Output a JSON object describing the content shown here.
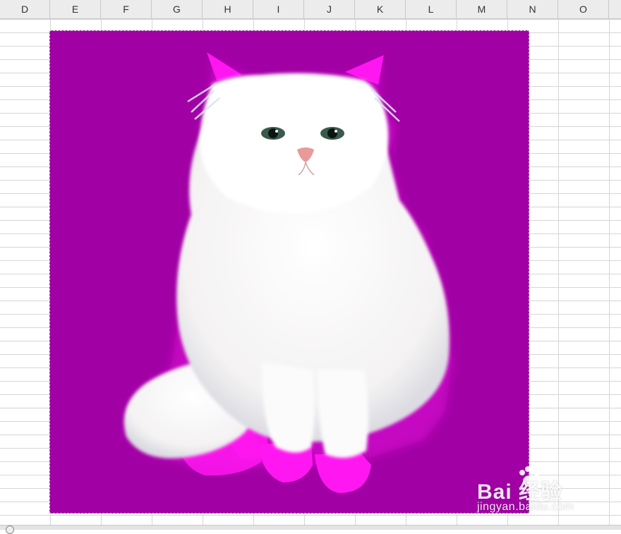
{
  "spreadsheet": {
    "columns": [
      "D",
      "E",
      "F",
      "G",
      "H",
      "I",
      "J",
      "K",
      "L",
      "M",
      "N",
      "O"
    ]
  },
  "image": {
    "subject": "white fluffy cat",
    "background_color": "#a100a5",
    "accent_color": "#ff16f0"
  },
  "watermark": {
    "brand": "Bai  经验",
    "sub": "jingyan.baidu.com"
  }
}
